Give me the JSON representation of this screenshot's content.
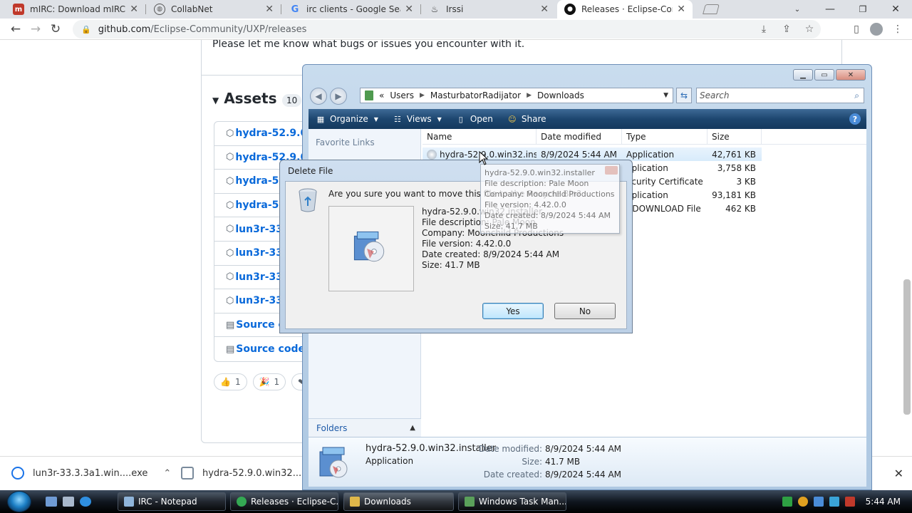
{
  "browser": {
    "tabs": [
      {
        "title": "mIRC: Download mIRC",
        "favicon": "mirc-icon",
        "color": "#c0392b"
      },
      {
        "title": "CollabNet",
        "favicon": "globe-icon",
        "color": "#555555"
      },
      {
        "title": "irc clients - Google Search",
        "favicon": "google-icon",
        "color": "#4285f4"
      },
      {
        "title": "Irssi",
        "favicon": "flame-icon",
        "color": "#333333"
      },
      {
        "title": "Releases · Eclipse-Community",
        "favicon": "github-icon",
        "color": "#111111"
      }
    ],
    "url_host": "github.com",
    "url_path": "/Eclipse-Community/UXP/releases"
  },
  "github": {
    "release_note": "Please let me know what bugs or issues you encounter with it.",
    "assets_title": "Assets",
    "assets_count": "10",
    "assets": [
      "hydra-52.9.0.",
      "hydra-52.9.0",
      "hydra-52",
      "hydra-52",
      "lun3r-33",
      "lun3r-33",
      "lun3r-33",
      "lun3r-33",
      "Source c",
      "Source code ("
    ],
    "reactions": [
      {
        "emoji": "👍",
        "count": "1"
      },
      {
        "emoji": "🎉",
        "count": "1"
      },
      {
        "emoji": "❤",
        "count": ""
      }
    ]
  },
  "downloads": {
    "items": [
      {
        "name": "lun3r-33.3.3a1.win....exe"
      },
      {
        "name": "hydra-52.9.0.win32....exe"
      }
    ]
  },
  "explorer": {
    "breadcrumbs": [
      "Users",
      "MasturbatorRadijator",
      "Downloads"
    ],
    "search_placeholder": "Search",
    "commands": [
      "Organize",
      "Views",
      "Open",
      "Share"
    ],
    "favorite_links_title": "Favorite Links",
    "folders_label": "Folders",
    "columns": [
      "Name",
      "Date modified",
      "Type",
      "Size"
    ],
    "files": [
      {
        "name": "hydra-52.9.0.win32.inst...",
        "date": "8/9/2024 5:44 AM",
        "type": "Application",
        "size": "42,761 KB"
      },
      {
        "name": "",
        "date": "",
        "type": "pplication",
        "size": "3,758 KB"
      },
      {
        "name": "",
        "date": "",
        "type": "ecurity Certificate",
        "size": "3 KB"
      },
      {
        "name": "",
        "date": "",
        "type": "pplication",
        "size": "93,181 KB"
      },
      {
        "name": "",
        "date": "",
        "type": "RDOWNLOAD File",
        "size": "462 KB"
      }
    ],
    "details": {
      "name": "hydra-52.9.0.win32.installer",
      "type": "Application",
      "date_modified_label": "Date modified:",
      "date_modified": "8/9/2024 5:44 AM",
      "size_label": "Size:",
      "size": "41.7 MB",
      "date_created_label": "Date created:",
      "date_created": "8/9/2024 5:44 AM"
    },
    "tooltip": [
      "hydra-52.9.0.win32.installer",
      "File description: Pale Moon",
      "Company: Moonchild Productions",
      "File version: 4.42.0.0",
      "Date created: 8/9/2024 5:44 AM",
      "Size: 41.7 MB"
    ]
  },
  "dialog": {
    "title": "Delete File",
    "question": "Are you sure you want to move this file to the Recycle Bin?",
    "file_lines": [
      "hydra-52.9.0.win32.installer",
      "File description: Pale Moon",
      "Company: Moonchild Productions",
      "File version: 4.42.0.0",
      "Date created: 8/9/2024 5:44 AM",
      "Size: 41.7 MB"
    ],
    "yes_label": "Yes",
    "no_label": "No"
  },
  "taskbar": {
    "tasks": [
      {
        "label": "IRC - Notepad",
        "color": "#8fb4d9"
      },
      {
        "label": "Releases · Eclipse-C...",
        "color": "#34a853"
      },
      {
        "label": "Downloads",
        "color": "#e0b84a"
      },
      {
        "label": "Windows Task Man...",
        "color": "#5aa05a"
      }
    ],
    "clock": "5:44 AM"
  }
}
